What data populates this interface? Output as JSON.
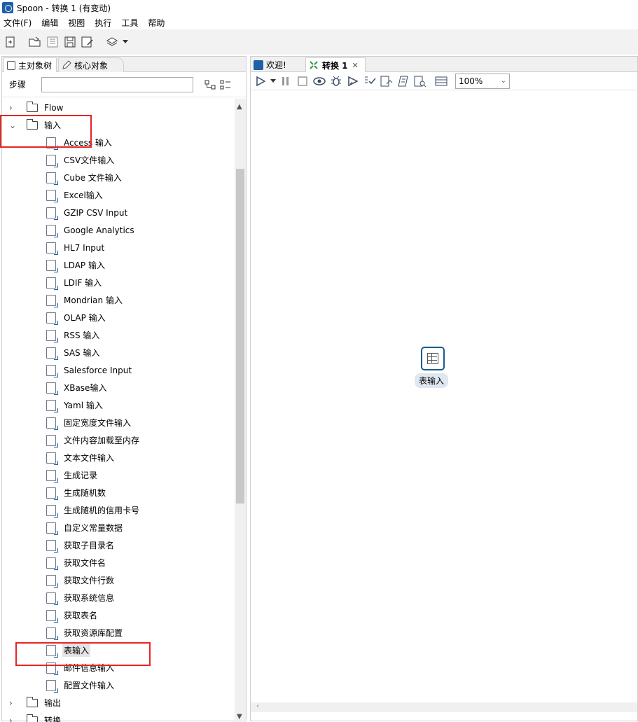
{
  "window": {
    "title": "Spoon - 转换 1 (有变动)"
  },
  "menu": [
    "文件(F)",
    "编辑",
    "视图",
    "执行",
    "工具",
    "帮助"
  ],
  "left_tabs": {
    "main": "主对象树",
    "core": "核心对象"
  },
  "search": {
    "label": "步骤",
    "value": ""
  },
  "tree": {
    "flow": "Flow",
    "input": "输入",
    "output": "输出",
    "transform": "转换",
    "input_steps": [
      "Access 输入",
      "CSV文件输入",
      "Cube 文件输入",
      "Excel输入",
      "GZIP CSV Input",
      "Google Analytics",
      "HL7 Input",
      "LDAP 输入",
      "LDIF 输入",
      "Mondrian 输入",
      "OLAP 输入",
      "RSS 输入",
      "SAS 输入",
      "Salesforce Input",
      "XBase输入",
      "Yaml 输入",
      "固定宽度文件输入",
      "文件内容加载至内存",
      "文本文件输入",
      "生成记录",
      "生成随机数",
      "生成随机的信用卡号",
      "自定义常量数据",
      "获取子目录名",
      "获取文件名",
      "获取文件行数",
      "获取系统信息",
      "获取表名",
      "获取资源库配置",
      "表输入",
      "邮件信息输入",
      "配置文件输入"
    ],
    "selected": "表输入"
  },
  "right_tabs": {
    "welcome": "欢迎!",
    "transform": "转换 1"
  },
  "zoom": "100%",
  "canvas": {
    "step_label": "表输入"
  },
  "colors": {
    "highlight": "#e82424",
    "node_border": "#1a5c8e"
  }
}
